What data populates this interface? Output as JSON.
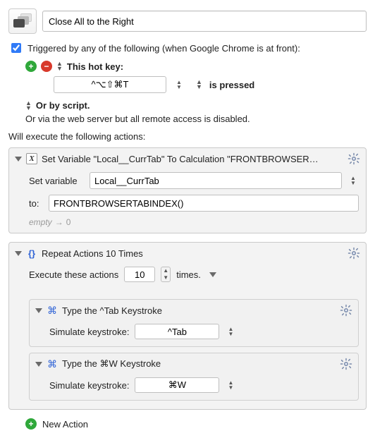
{
  "macro": {
    "name": "Close All to the Right",
    "triggered_label": "Triggered by any of the following (when Google Chrome is at front):",
    "triggered_checked": true
  },
  "trigger": {
    "hotkey_heading": "This hot key:",
    "hotkey_value": "^⌥⇧⌘T",
    "state_label": "is pressed",
    "or_script": "Or by script.",
    "or_web": "Or via the web server but all remote access is disabled."
  },
  "actions_intro": "Will execute the following actions:",
  "action_setvar": {
    "title": "Set Variable \"Local__CurrTab\" To Calculation \"FRONTBROWSER…",
    "label_var": "Set variable",
    "var_value": "Local__CurrTab",
    "label_to": "to:",
    "to_value": "FRONTBROWSERTABINDEX()",
    "result_left": "empty",
    "result_right": "0"
  },
  "action_repeat": {
    "title": "Repeat Actions 10 Times",
    "exec_label": "Execute these actions",
    "count": "10",
    "times_label": "times.",
    "step1": {
      "title": "Type the ^Tab Keystroke",
      "sim_label": "Simulate keystroke:",
      "key": "^Tab"
    },
    "step2": {
      "title": "Type the ⌘W Keystroke",
      "sim_label": "Simulate keystroke:",
      "key": "⌘W"
    }
  },
  "new_action_label": "New Action"
}
